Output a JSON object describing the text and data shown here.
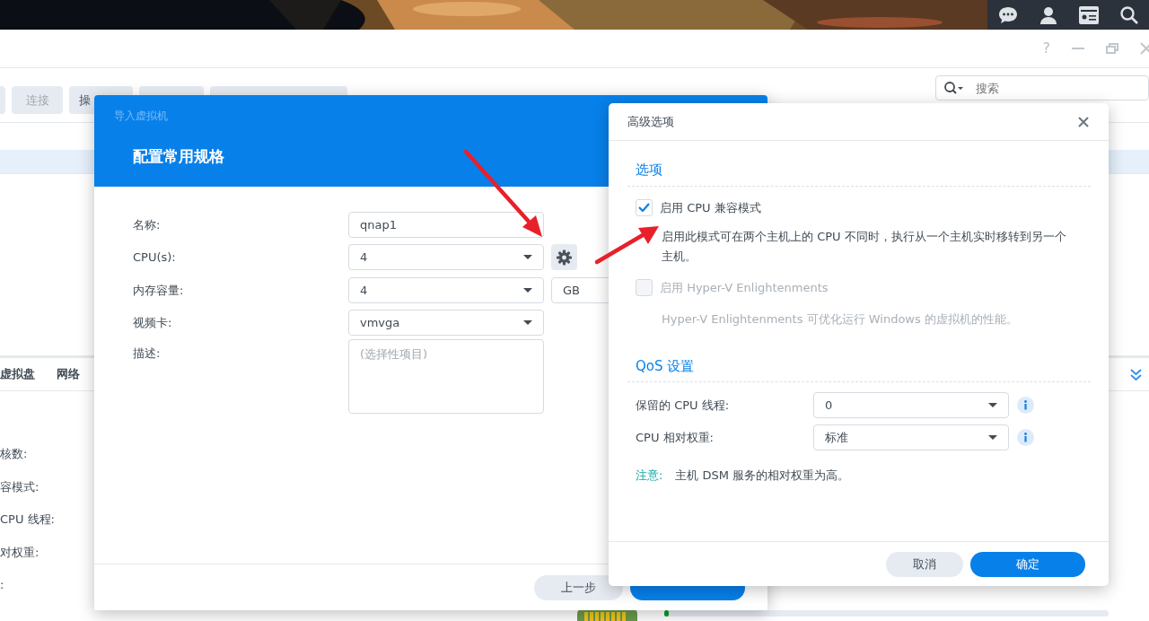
{
  "window": {
    "help_glyph": "?"
  },
  "toolbar": {
    "buttons": [
      {
        "label": "连接",
        "disabled": true
      },
      {
        "label": "操",
        "disabled": false
      }
    ],
    "search": {
      "placeholder": "搜索"
    }
  },
  "vm_list": {
    "rows": [
      {
        "selected": true
      }
    ]
  },
  "detail_panel": {
    "tabs": [
      "虚拟盘",
      "网络"
    ],
    "labels": [
      "核数:",
      "容模式:",
      "CPU 线程:",
      "对权重:",
      ":"
    ],
    "progress": {
      "level": 0.01
    }
  },
  "import_dialog": {
    "subtitle": "导入虚拟机",
    "title": "配置常用规格",
    "fields": [
      {
        "label": "名称:",
        "kind": "text",
        "value": "qnap1",
        "has_settings": false
      },
      {
        "label": "CPU(s):",
        "kind": "select",
        "value": "4",
        "has_settings": true
      },
      {
        "label": "内存容量:",
        "kind": "select",
        "value": "4",
        "unit": "GB",
        "has_settings": false
      },
      {
        "label": "视频卡:",
        "kind": "select",
        "value": "vmvga",
        "has_settings": false
      },
      {
        "label": "描述:",
        "kind": "textarea",
        "placeholder": "(选择性项目)",
        "has_settings": false
      }
    ],
    "buttons": [
      {
        "kind": "secondary",
        "label": "上一步"
      },
      {
        "kind": "primary"
      }
    ]
  },
  "advanced_dialog": {
    "title": "高级选项",
    "options_section": {
      "heading": "选项",
      "options": [
        {
          "label": "启用 CPU 兼容模式",
          "checked": true,
          "disabled": false,
          "description": "启用此模式可在两个主机上的 CPU 不同时，执行从一个主机实时移转到另一个主机。"
        },
        {
          "label": "启用 Hyper-V Enlightenments",
          "checked": false,
          "disabled": true,
          "description": "Hyper-V Enlightenments 可优化运行 Windows 的虚拟机的性能。"
        }
      ]
    },
    "qos_section": {
      "heading": "QoS 设置",
      "settings": [
        {
          "label": "保留的 CPU 线程:",
          "value": "0"
        },
        {
          "label": "CPU 相对权重:",
          "value": "标准"
        }
      ],
      "note": {
        "label": "注意:",
        "text": "主机 DSM 服务的相对权重为高。"
      }
    },
    "buttons": [
      {
        "kind": "secondary",
        "label": "取消"
      },
      {
        "kind": "primary",
        "label": "确定"
      }
    ]
  }
}
